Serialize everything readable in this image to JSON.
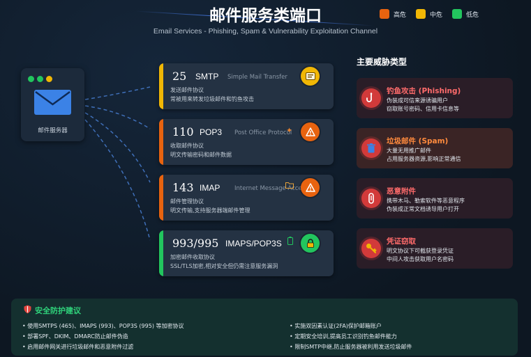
{
  "header": {
    "title": "邮件服务类端口",
    "subtitle": "Email Services - Phishing, Spam & Vulnerability Exploitation Channel"
  },
  "legend": [
    {
      "label": "高危",
      "color": "#e8630f"
    },
    {
      "label": "中危",
      "color": "#f1b705"
    },
    {
      "label": "低危",
      "color": "#22c55e"
    }
  ],
  "server": {
    "label": "邮件服务器",
    "icon": "envelope-icon",
    "dot_colors": [
      "#22c55e",
      "#22c55e",
      "#f1b705"
    ]
  },
  "ports": [
    {
      "number": "25",
      "protocol": "SMTP",
      "full_name": "Simple Mail Transfer",
      "line1": "发送邮件协议",
      "line2": "常被用来转发垃圾邮件和钓鱼攻击",
      "level_color": "#f1b705",
      "badge_icon": "message-icon"
    },
    {
      "number": "110",
      "protocol": "POP3",
      "full_name": "Post Office Protocol",
      "line1": "收取邮件协议",
      "line2": "明文传输密码和邮件数据",
      "level_color": "#e8630f",
      "badge_icon": "warning-icon"
    },
    {
      "number": "143",
      "protocol": "IMAP",
      "full_name": "Internet Message Access",
      "line1": "邮件管理协议",
      "line2": "明文传输,支持服务器端邮件管理",
      "level_color": "#e8630f",
      "badge_icon": "warning-icon"
    },
    {
      "number": "993/995",
      "protocol": "IMAPS/POP3S",
      "full_name": "",
      "line1": "加密邮件收取协议",
      "line2": "SSL/TLS加密,相对安全但仍需注意服务漏洞",
      "level_color": "#22c55e",
      "badge_icon": "lock-icon"
    }
  ],
  "threats": {
    "title": "主要威胁类型",
    "items": [
      {
        "name": "钓鱼攻击 (Phishing)",
        "line1": "伪装成可信来源诱骗用户",
        "line2": "窃取账号密码、信用卡信息等",
        "name_color": "#ff6b6b",
        "icon": "hook-icon"
      },
      {
        "name": "垃圾邮件 (Spam)",
        "line1": "大量无用推广邮件",
        "line2": "占用服务器资源,影响正常通信",
        "name_color": "#ff8a3d",
        "icon": "trash-icon"
      },
      {
        "name": "恶意附件",
        "line1": "携带木马、勒索软件等恶意程序",
        "line2": "伪装成正常文档诱导用户打开",
        "name_color": "#ff6b6b",
        "icon": "paperclip-icon"
      },
      {
        "name": "凭证窃取",
        "line1": "明文协议下可截获登录凭证",
        "line2": "中间人攻击获取用户名密码",
        "name_color": "#ff6b6b",
        "icon": "key-icon"
      }
    ]
  },
  "advice": {
    "title": "安全防护建议",
    "left": [
      "• 使用SMTPS (465)、IMAPS (993)、POP3S (995) 等加密协议",
      "• 部署SPF、DKIM、DMARC防止邮件伪造",
      "• 启用邮件网关进行垃圾邮件和恶意附件过滤"
    ],
    "right": [
      "• 实施双因素认证(2FA)保护邮箱账户",
      "• 定期安全培训,提高员工识别钓鱼邮件能力",
      "• 限制SMTP中继,防止服务器被利用发送垃圾邮件"
    ]
  }
}
